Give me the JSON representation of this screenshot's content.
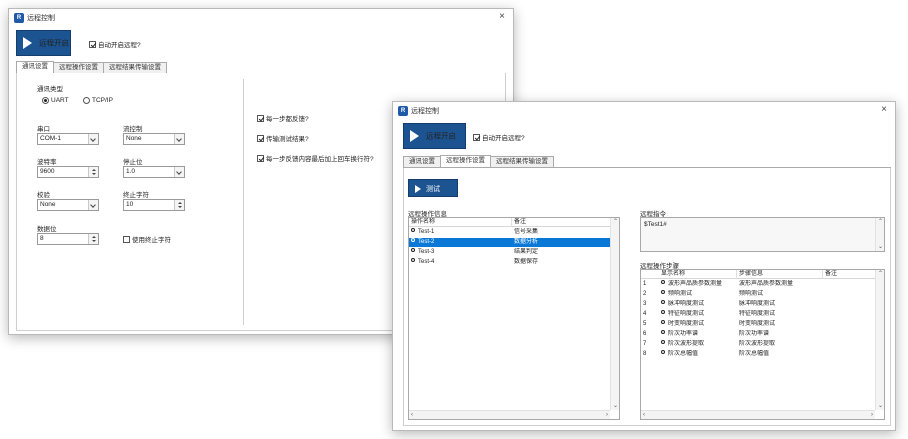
{
  "back_window": {
    "title": "远程控制",
    "close": "×",
    "run_label": "远程开启",
    "auto_start_label": "自动开启远程?",
    "tabs": [
      "通讯设置",
      "远程操作设置",
      "远程结果传输设置"
    ],
    "comm_type_label": "通讯类型",
    "radio_uart": "UART",
    "radio_tcp": "TCP/IP",
    "port_label": "串口",
    "port_value": "COM-1",
    "flow_label": "流控制",
    "flow_value": "None",
    "baud_label": "波特率",
    "baud_value": "9600",
    "stopbit_label": "停止位",
    "stopbit_value": "1.0",
    "parity_label": "校验",
    "parity_value": "None",
    "endchar_label": "终止字符",
    "endchar_value": "10",
    "databits_label": "数据位",
    "databits_value": "8",
    "use_endchar_label": "使用终止字符",
    "opt1_label": "每一步都反馈?",
    "opt2_label": "传输测试结果?",
    "opt3_label": "每一步反馈内容最后加上回车换行符?"
  },
  "front_window": {
    "title": "远程控制",
    "close": "×",
    "run_label": "远程开启",
    "auto_start_label": "自动开启远程?",
    "tabs": [
      "通讯设置",
      "远程操作设置",
      "远程结果传输设置"
    ],
    "test_label": "测试",
    "info_label": "远程操作信息",
    "info_headers": [
      "操作名称",
      "备注"
    ],
    "info_rows": [
      {
        "name": "Test-1",
        "note": "信号采集"
      },
      {
        "name": "Test-2",
        "note": "数据分析"
      },
      {
        "name": "Test-3",
        "note": "结果判定"
      },
      {
        "name": "Test-4",
        "note": "数据保存"
      }
    ],
    "cmd_label": "远程指令",
    "cmd_value": "$Test1#",
    "steps_label": "远程操作步骤",
    "steps_headers": [
      "显示名称",
      "步骤信息",
      "备注"
    ],
    "steps_rows": [
      {
        "n": "1",
        "name": "波形声品质参数测量",
        "info": "波形声品质参数测量"
      },
      {
        "n": "2",
        "name": "频响测试",
        "info": "频响测试"
      },
      {
        "n": "3",
        "name": "脉冲响度测试",
        "info": "脉冲响度测试"
      },
      {
        "n": "4",
        "name": "特征响度测试",
        "info": "特征响度测试"
      },
      {
        "n": "5",
        "name": "时变响度测试",
        "info": "时变响度测试"
      },
      {
        "n": "6",
        "name": "阶次功率谱",
        "info": "阶次功率谱"
      },
      {
        "n": "7",
        "name": "阶次波形提取",
        "info": "阶次波形提取"
      },
      {
        "n": "8",
        "name": "阶次总幅值",
        "info": "阶次总幅值"
      }
    ]
  },
  "colors": {
    "accent": "#1c5492",
    "selection": "#0a78d7"
  }
}
